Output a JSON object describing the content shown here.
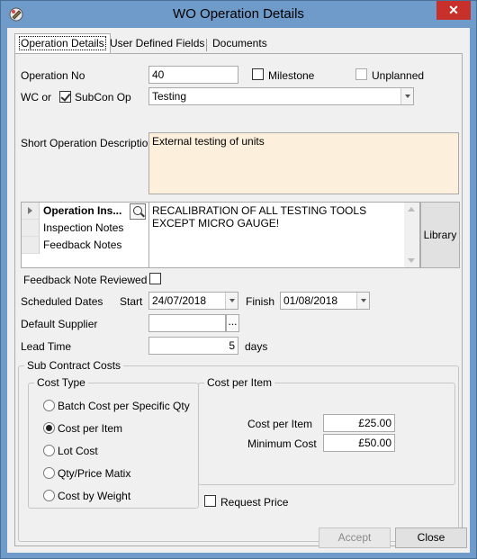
{
  "window": {
    "title": "WO Operation Details",
    "close_glyph": "✕"
  },
  "tabs": [
    {
      "label": "Operation Details",
      "active": true
    },
    {
      "label": "User Defined Fields",
      "active": false
    },
    {
      "label": "Documents",
      "active": false
    }
  ],
  "form": {
    "operation_no_label": "Operation No",
    "operation_no": "40",
    "milestone_label": "Milestone",
    "milestone_checked": false,
    "unplanned_label": "Unplanned",
    "unplanned_checked": false,
    "wc_or_label": "WC or",
    "subcon_op_label": "SubCon Op",
    "subcon_op_checked": true,
    "wc_value": "Testing",
    "short_desc_label": "Short Operation Description",
    "short_desc": "External testing of units",
    "notes_grid": {
      "rows": [
        {
          "label": "Operation Ins...",
          "selected": true
        },
        {
          "label": "Inspection Notes",
          "selected": false
        },
        {
          "label": "Feedback Notes",
          "selected": false
        }
      ],
      "note_text": "RECALIBRATION OF ALL TESTING TOOLS EXCEPT MICRO GAUGE!",
      "library_label": "Library"
    },
    "feedback_reviewed_label": "Feedback Note Reviewed",
    "feedback_reviewed_checked": false,
    "scheduled_dates_label": "Scheduled Dates",
    "start_label": "Start",
    "start_date": "24/07/2018",
    "finish_label": "Finish",
    "finish_date": "01/08/2018",
    "default_supplier_label": "Default Supplier",
    "default_supplier": "",
    "browse_glyph": "...",
    "lead_time_label": "Lead Time",
    "lead_time": "5",
    "lead_time_unit": "days"
  },
  "subcon": {
    "group_title": "Sub Contract Costs",
    "cost_type_title": "Cost Type",
    "cost_types": [
      {
        "label": "Batch Cost per Specific Qty",
        "selected": false
      },
      {
        "label": "Cost per Item",
        "selected": true
      },
      {
        "label": "Lot Cost",
        "selected": false
      },
      {
        "label": "Qty/Price Matix",
        "selected": false
      },
      {
        "label": "Cost by Weight",
        "selected": false
      }
    ],
    "cost_per_item_title": "Cost per Item",
    "cost_per_item_label": "Cost per Item",
    "cost_per_item_value": "£25.00",
    "minimum_cost_label": "Minimum Cost",
    "minimum_cost_value": "£50.00",
    "request_price_label": "Request Price",
    "request_price_checked": false
  },
  "footer": {
    "accept_label": "Accept",
    "close_label": "Close"
  },
  "colors": {
    "title_bar": "#6f9bcb",
    "close_button": "#c7302b",
    "description_bg": "#fcf0dc"
  }
}
